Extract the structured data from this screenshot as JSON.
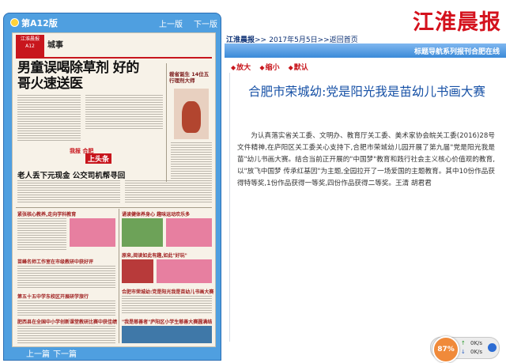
{
  "brand": {
    "name": "江淮晨报",
    "color": "#d4121d"
  },
  "breadcrumb": {
    "site": "江淮晨报",
    "sep1": ">>",
    "date": "2017年5月5日",
    "sep2": ">>",
    "home": "返回首页"
  },
  "bluebar": {
    "text": "标题导航系列报刊合肥在线",
    "color": "#3b8ad8"
  },
  "tools": {
    "enlarge": "放大",
    "shrink": "缩小",
    "default": "默认"
  },
  "left_panel": {
    "edition": "第A12版",
    "prev_page": "上一版",
    "next_page": "下一版",
    "prev_article": "上一篇",
    "next_article": "下一篇"
  },
  "paper": {
    "masthead": "江淮晨报 A12",
    "section": "城事",
    "headline1": "男童误喝除草剂 好的哥火速送医",
    "side_headline": "裁省诞生 14位五行理剂大师",
    "logo_badge": "我报 合肥",
    "hot_badge": "上头条",
    "headline2": "老人丢下元现金 公交司机帮寻回",
    "small1": "紧张核心教养,走向学科教育",
    "small2": "诵读健体养身心 趣味运动欢乐多",
    "small3": "苗峰名师工作室在市级教研中获好评",
    "small4": "原来,阅读如此有趣,如此\"好玩\"",
    "small5": "第五十五中学东校区开展研学旅行",
    "small6": "合肥市荣城幼:党是阳光我是苗幼儿书画大赛",
    "small7": "\"我是慈善者\"庐阳区小学生慈善大赛圆满结束",
    "small8": "肥西县在全国中小学创新课堂教研比赛中获佳绩"
  },
  "article": {
    "title": "合肥市荣城幼:党是阳光我是苗幼儿书画大赛",
    "body": "为认真落实省关工委、文明办、教育厅关工委、美术家协会皖关工委(2016)28号文件精神,在庐阳区关工委关心支持下,合肥市荣城幼儿园开展了第九届\"党是阳光我是苗\"幼儿书画大赛。结合当前正开展的\"中国梦\"教育和践行社会主义核心价值观的教育,以\"放飞中国梦 传承红基因\"为主题,全园拉开了一场爱国的主题教育。其中10份作品获得特等奖,1份作品获得一等奖,四份作品获得二等奖。王清 胡君君"
  },
  "widget": {
    "percent": "87%",
    "up_arrow": "↑",
    "down_arrow": "↓",
    "upload": "0K/s",
    "download": "0K/s"
  }
}
